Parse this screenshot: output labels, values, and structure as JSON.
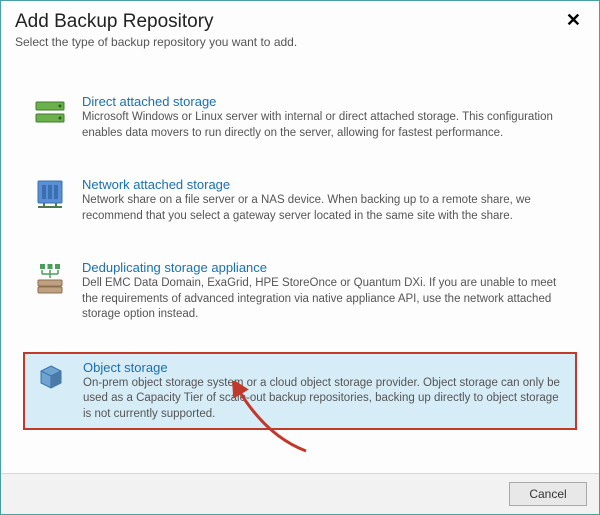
{
  "dialog": {
    "title": "Add Backup Repository",
    "subtitle": "Select the type of backup repository you want to add.",
    "close_glyph": "✕"
  },
  "options": [
    {
      "title": "Direct attached storage",
      "desc": "Microsoft Windows or Linux server with internal or direct attached storage. This configuration enables data movers to run directly on the server, allowing for fastest performance."
    },
    {
      "title": "Network attached storage",
      "desc": "Network share on a file server or a NAS device. When backing up to a remote share, we recommend that you select a gateway server located in the same site with the share."
    },
    {
      "title": "Deduplicating storage appliance",
      "desc": "Dell EMC Data Domain, ExaGrid, HPE StoreOnce or Quantum DXi. If you are unable to meet the requirements of advanced integration via native appliance API, use the network attached storage option instead."
    },
    {
      "title": "Object storage",
      "desc": "On-prem object storage system or a cloud object storage provider. Object storage can only be used as a Capacity Tier of scale-out backup repositories, backing up directly to object storage is not currently supported."
    }
  ],
  "footer": {
    "cancel_label": "Cancel"
  }
}
